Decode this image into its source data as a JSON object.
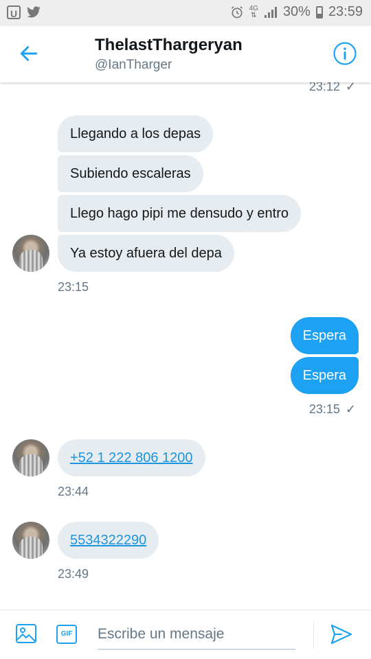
{
  "status_bar": {
    "battery": "30%",
    "time": "23:59",
    "network": "4G"
  },
  "header": {
    "name": "ThelastThargeryan",
    "handle": "@IanTharger"
  },
  "messages": {
    "top_timestamp": "23:12",
    "group1": [
      "Llegando a los depas",
      "Subiendo escaleras",
      "Llego hago pipi me densudo y entro",
      "Ya estoy afuera del depa"
    ],
    "group1_time": "23:15",
    "sent": [
      "Espera",
      "Espera"
    ],
    "sent_time": "23:15",
    "phone1": "+52 1 222 806 1200",
    "phone1_time": "23:44",
    "phone2": "5534322290",
    "phone2_time": "23:49"
  },
  "composer": {
    "placeholder": "Escribe un mensaje",
    "gif_label": "GIF"
  },
  "colors": {
    "accent": "#1da1f2",
    "incoming_bubble": "#e6ecf0",
    "muted_text": "#657786"
  },
  "icons": [
    "back-arrow-icon",
    "info-icon",
    "image-icon",
    "gif-icon",
    "send-icon",
    "check-icon"
  ]
}
